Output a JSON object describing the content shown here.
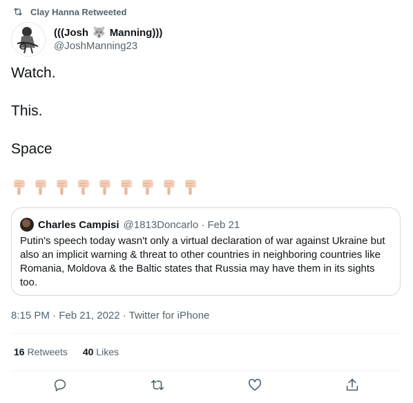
{
  "retweet_context": {
    "label": "Clay Hanna Retweeted",
    "icon": "retweet-icon"
  },
  "author": {
    "name_prefix": "(((Josh",
    "name_emoji": "🐺",
    "name_suffix": "Manning)))",
    "handle": "@JoshManning23"
  },
  "tweet": {
    "lines": [
      "Watch.",
      "This.",
      "Space"
    ],
    "emoji_name": "backhand-index-pointing-down",
    "emoji_count": 9
  },
  "quote": {
    "name": "Charles Campisi",
    "handle_date": "@1813Doncarlo · Feb 21",
    "text": "Putin's speech today wasn't only a virtual declaration of war against Ukraine but also an implicit warning & threat to other countries in neighboring countries like Romania, Moldova & the Baltic states that Russia may have them in its sights too."
  },
  "timestamp": "8:15 PM · Feb 21, 2022 · Twitter for iPhone",
  "stats": {
    "retweets_count": "16",
    "retweets_label": "Retweets",
    "likes_count": "40",
    "likes_label": "Likes"
  },
  "actions": [
    "reply-icon",
    "retweet-icon",
    "like-icon",
    "share-icon"
  ],
  "colors": {
    "text": "#0f1419",
    "secondary": "#536471",
    "border": "#cfd9de",
    "finger": "#f3cdb8"
  }
}
